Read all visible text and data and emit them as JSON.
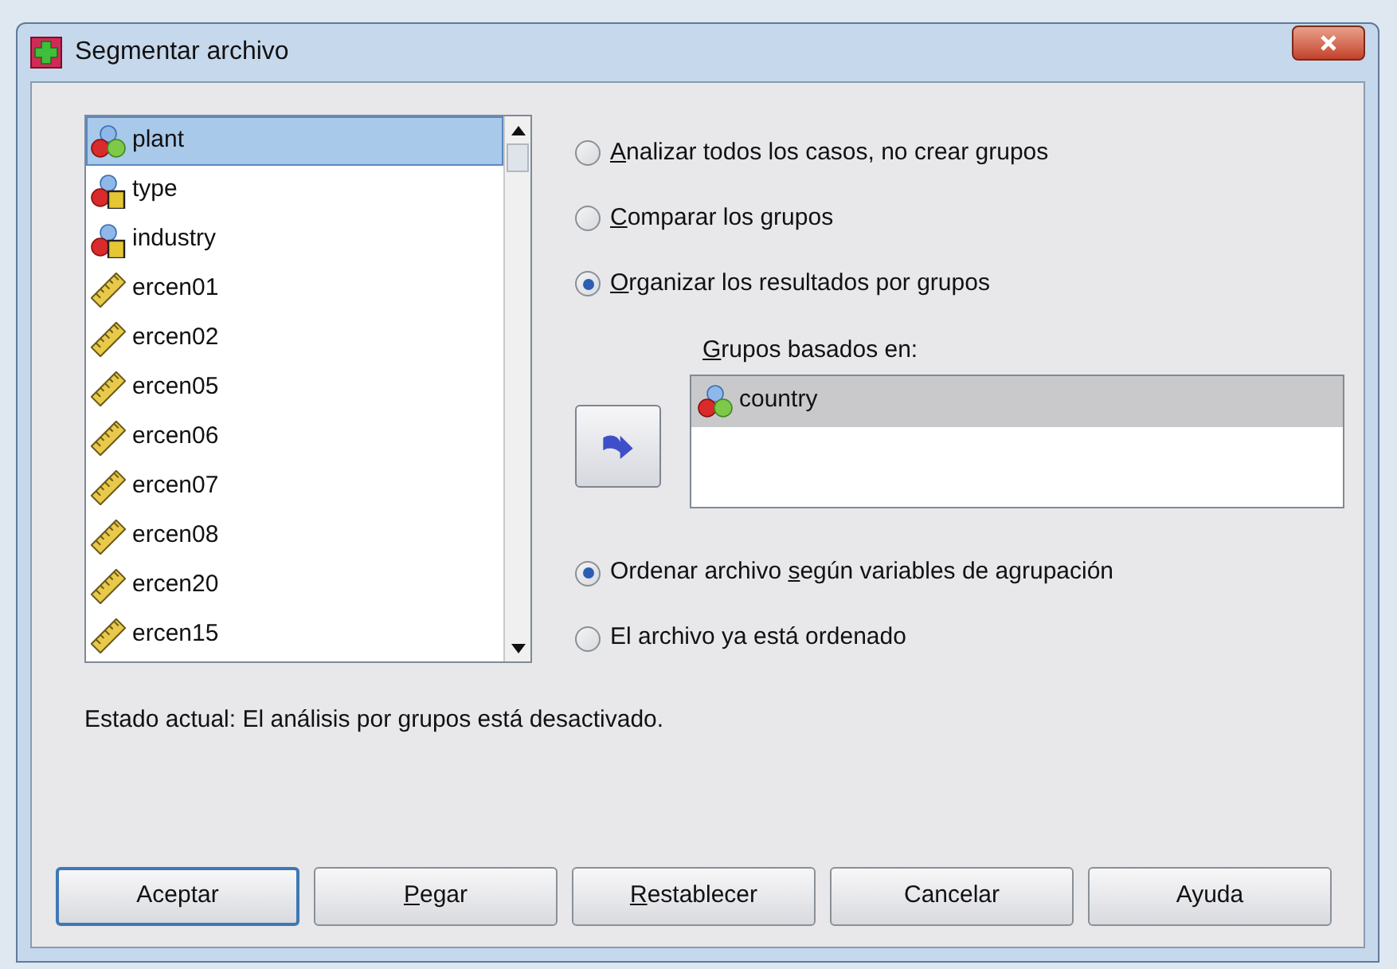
{
  "window": {
    "title": "Segmentar archivo"
  },
  "variables": [
    {
      "name": "plant",
      "kind": "nominal",
      "selected": true
    },
    {
      "name": "type",
      "kind": "nominal_string",
      "selected": false
    },
    {
      "name": "industry",
      "kind": "nominal_string",
      "selected": false
    },
    {
      "name": "ercen01",
      "kind": "scale",
      "selected": false
    },
    {
      "name": "ercen02",
      "kind": "scale",
      "selected": false
    },
    {
      "name": "ercen05",
      "kind": "scale",
      "selected": false
    },
    {
      "name": "ercen06",
      "kind": "scale",
      "selected": false
    },
    {
      "name": "ercen07",
      "kind": "scale",
      "selected": false
    },
    {
      "name": "ercen08",
      "kind": "scale",
      "selected": false
    },
    {
      "name": "ercen20",
      "kind": "scale",
      "selected": false
    },
    {
      "name": "ercen15",
      "kind": "scale",
      "selected": false
    }
  ],
  "mode_options": [
    {
      "underlined": "A",
      "after": "nalizar todos los casos, no crear grupos",
      "selected": false
    },
    {
      "underlined": "C",
      "after": "omparar los grupos",
      "selected": false
    },
    {
      "underlined": "O",
      "after": "rganizar los resultados por grupos",
      "selected": true
    }
  ],
  "groups_label": {
    "underlined": "G",
    "after": "rupos basados en:"
  },
  "groups": [
    {
      "name": "country",
      "kind": "nominal",
      "selected": true
    }
  ],
  "sort_options": [
    {
      "before": "Ordenar archivo ",
      "underlined": "s",
      "after": "egún variables de agrupación",
      "selected": true
    },
    {
      "after": "El archivo ya está ordenado",
      "selected": false
    }
  ],
  "status": "Estado actual: El análisis por grupos está desactivado.",
  "buttons": [
    {
      "after": "Aceptar",
      "default": true
    },
    {
      "underlined": "P",
      "after": "egar",
      "default": false
    },
    {
      "underlined": "R",
      "after": "establecer",
      "default": false
    },
    {
      "after": "Cancelar",
      "default": false
    },
    {
      "after": "Ayuda",
      "default": false
    }
  ]
}
